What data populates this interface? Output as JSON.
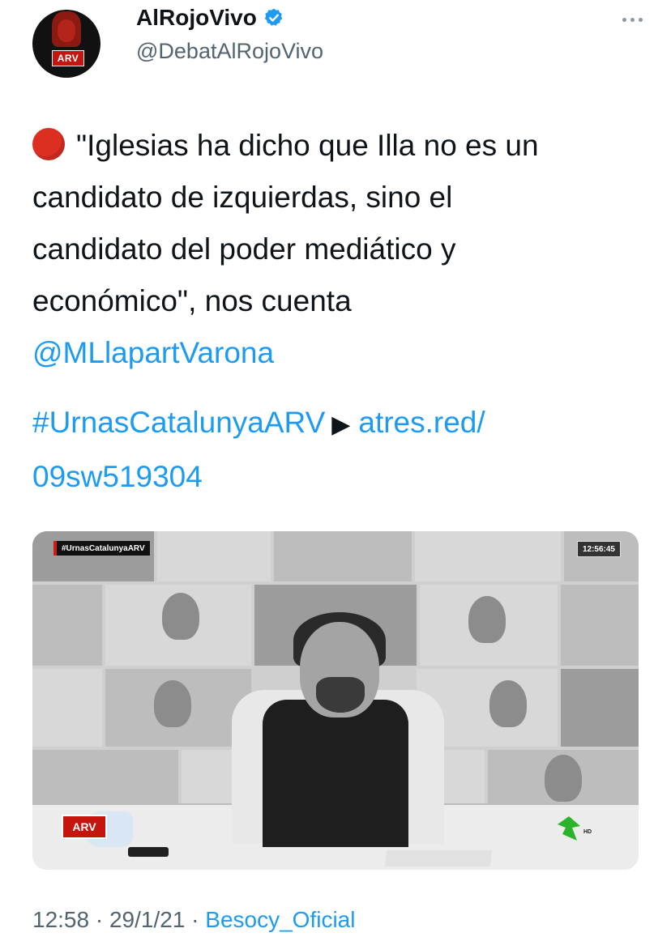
{
  "author": {
    "display_name": "AlRojoVivo",
    "handle": "@DebatAlRojoVivo",
    "avatar_logo_text": "ARV",
    "verified": true
  },
  "tweet": {
    "text_lines": [
      "\"Iglesias ha dicho que Illa no es un",
      "candidato de izquierdas, sino el",
      "candidato del poder mediático y",
      "económico\", nos cuenta"
    ],
    "mention": "@MLlapartVarona",
    "hashtag": "#UrnasCatalunyaARV",
    "link_part1": "atres.red/",
    "link_part2": "09sw519304"
  },
  "media": {
    "tag": "#UrnasCatalunyaARV",
    "clock": "12:56:45",
    "logo": "ARV",
    "channel_badge": "HD"
  },
  "meta": {
    "time": "12:58",
    "separator": "·",
    "date": "29/1/21",
    "source": "Besocy_Oficial"
  },
  "colors": {
    "link": "#1d9bf0",
    "muted": "#536471",
    "red_emoji": "#dd2e22",
    "verified": "#1d9bf0"
  },
  "icons": {
    "verified": "verified-badge-icon",
    "more": "more-dots-icon",
    "emoji": "red-circle-emoji-icon",
    "play": "play-triangle-icon"
  }
}
